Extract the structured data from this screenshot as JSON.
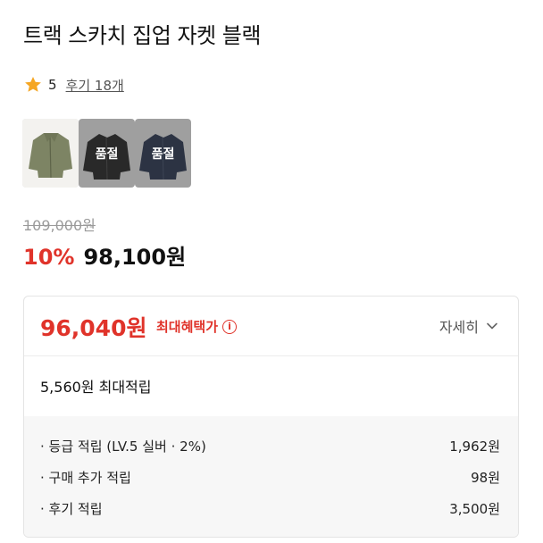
{
  "product": {
    "title": "트랙 스카치 집업 자켓 블랙",
    "rating_score": "5",
    "review_link": "후기 18개"
  },
  "thumbnails": [
    {
      "color": "khaki",
      "soldout_label": ""
    },
    {
      "color": "black",
      "soldout_label": "품절"
    },
    {
      "color": "navy",
      "soldout_label": "품절"
    }
  ],
  "price": {
    "original": "109,000원",
    "discount": "10%",
    "sale": "98,100원"
  },
  "benefit_card": {
    "best_price": "96,040원",
    "best_price_label": "최대혜택가",
    "info_icon": "ⓘ",
    "detail_label": "자세히",
    "max_points": "5,560원 최대적립",
    "breakdown": [
      {
        "label": "· 등급 적립 (LV.5 실버 · 2%)",
        "value": "1,962원"
      },
      {
        "label": "· 구매 추가 적립",
        "value": "98원"
      },
      {
        "label": "· 후기 적립",
        "value": "3,500원"
      }
    ]
  },
  "colors": {
    "accent_red": "#e0332a",
    "star": "#f5a623"
  },
  "icons": {
    "rating": "star-icon",
    "info": "info-icon",
    "expand": "chevron-down-icon"
  }
}
